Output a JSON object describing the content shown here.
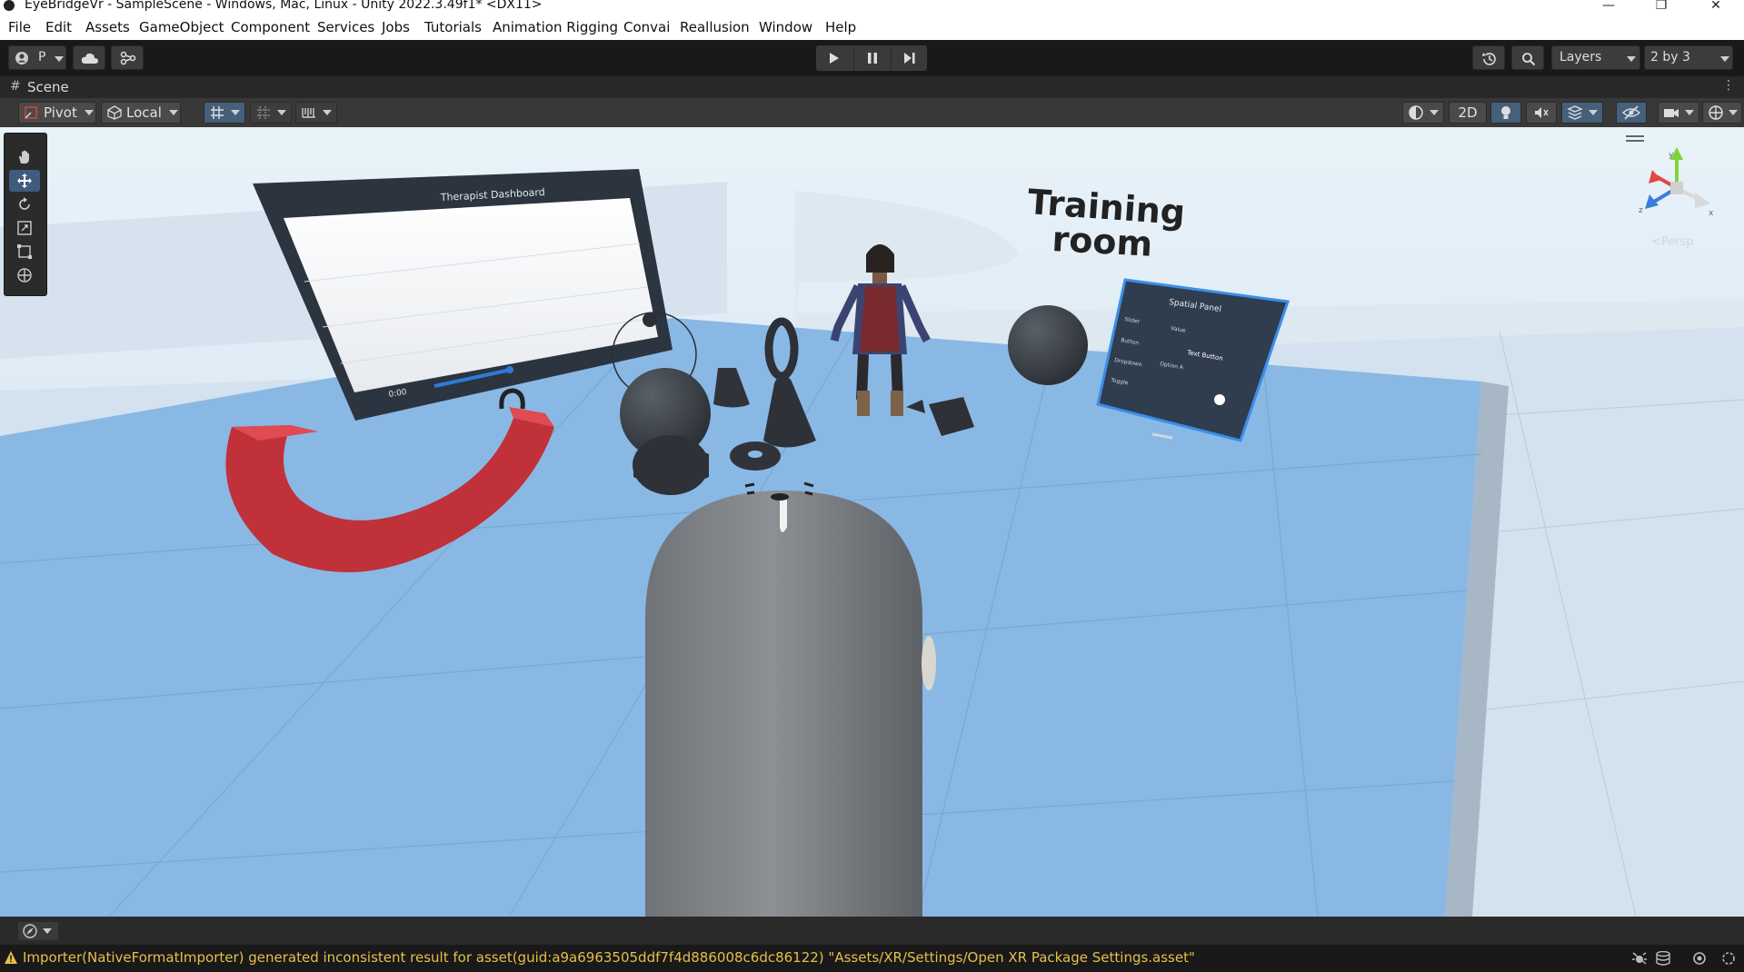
{
  "window": {
    "title": "EyeBridgeVr - SampleScene - Windows, Mac, Linux - Unity 2022.3.49f1* <DX11>",
    "controls": [
      "minimize-icon",
      "restore-icon",
      "close-icon"
    ]
  },
  "menu": {
    "items": [
      "File",
      "Edit",
      "Assets",
      "GameObject",
      "Component",
      "Services",
      "Jobs",
      "Tutorials",
      "Animation Rigging",
      "Convai",
      "Reallusion",
      "Window",
      "Help"
    ]
  },
  "toolbar": {
    "account_label": "P",
    "layers_label": "Layers",
    "layout_label": "2 by 3"
  },
  "scene_tab": {
    "label": "Scene"
  },
  "scene_toolbar": {
    "pivot_label": "Pivot",
    "space_label": "Local",
    "mode_2d_label": "2D"
  },
  "viewport": {
    "dashboard_title": "Therapist Dashboard",
    "video_time": "0:00",
    "room_sign_line1": "Training",
    "room_sign_line2": "room",
    "panel_title": "Spatial Panel",
    "panel_rows": [
      "Slider",
      "Button",
      "Dropdown",
      "Toggle"
    ],
    "panel_values": [
      "Value",
      "Text Button",
      "Option A"
    ],
    "gizmo_axes": [
      "y",
      "z",
      "x"
    ],
    "projection_label": "<Persp"
  },
  "status": {
    "message": "Importer(NativeFormatImporter) generated inconsistent result for asset(guid:a9a6963505ddf7f4d886008c6dc86122) \"Assets/XR/Settings/Open XR Package Settings.asset\""
  },
  "colors": {
    "toolbar_bg": "#191919",
    "active_blue": "#46607c",
    "warning": "#e3c04a",
    "floor_blue": "#8ab8e4"
  }
}
